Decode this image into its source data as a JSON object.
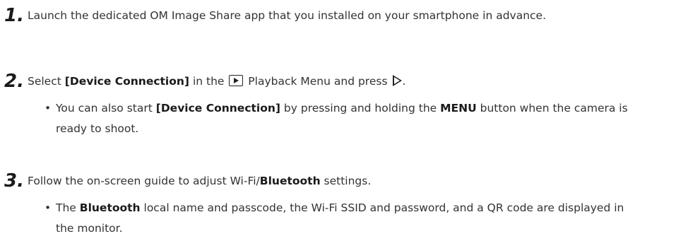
{
  "steps": [
    {
      "number": "1.",
      "text": "Launch the dedicated OM Image Share app that you installed on your smartphone in advance."
    },
    {
      "number": "2.",
      "text_pre": "Select ",
      "text_bold": "[Device Connection]",
      "text_mid": " in the ",
      "icon": "playback-icon",
      "text_post": " Playback Menu and press ",
      "arrow_icon": "right-arrow-icon",
      "text_end": ".",
      "bullet": {
        "pre": "You can also start ",
        "bold1": "[Device Connection]",
        "mid": " by pressing and holding the ",
        "bold2": "MENU",
        "post": " button when the camera is ready to shoot."
      }
    },
    {
      "number": "3.",
      "text_pre": "Follow the on-screen guide to adjust Wi-Fi/",
      "text_bold": "Bluetooth",
      "text_post": " settings.",
      "bullet": {
        "pre": "The ",
        "bold1": "Bluetooth",
        "post": " local name and passcode, the Wi-Fi SSID and password, and a QR code are displayed in the monitor."
      }
    }
  ],
  "bullet_char": "•"
}
